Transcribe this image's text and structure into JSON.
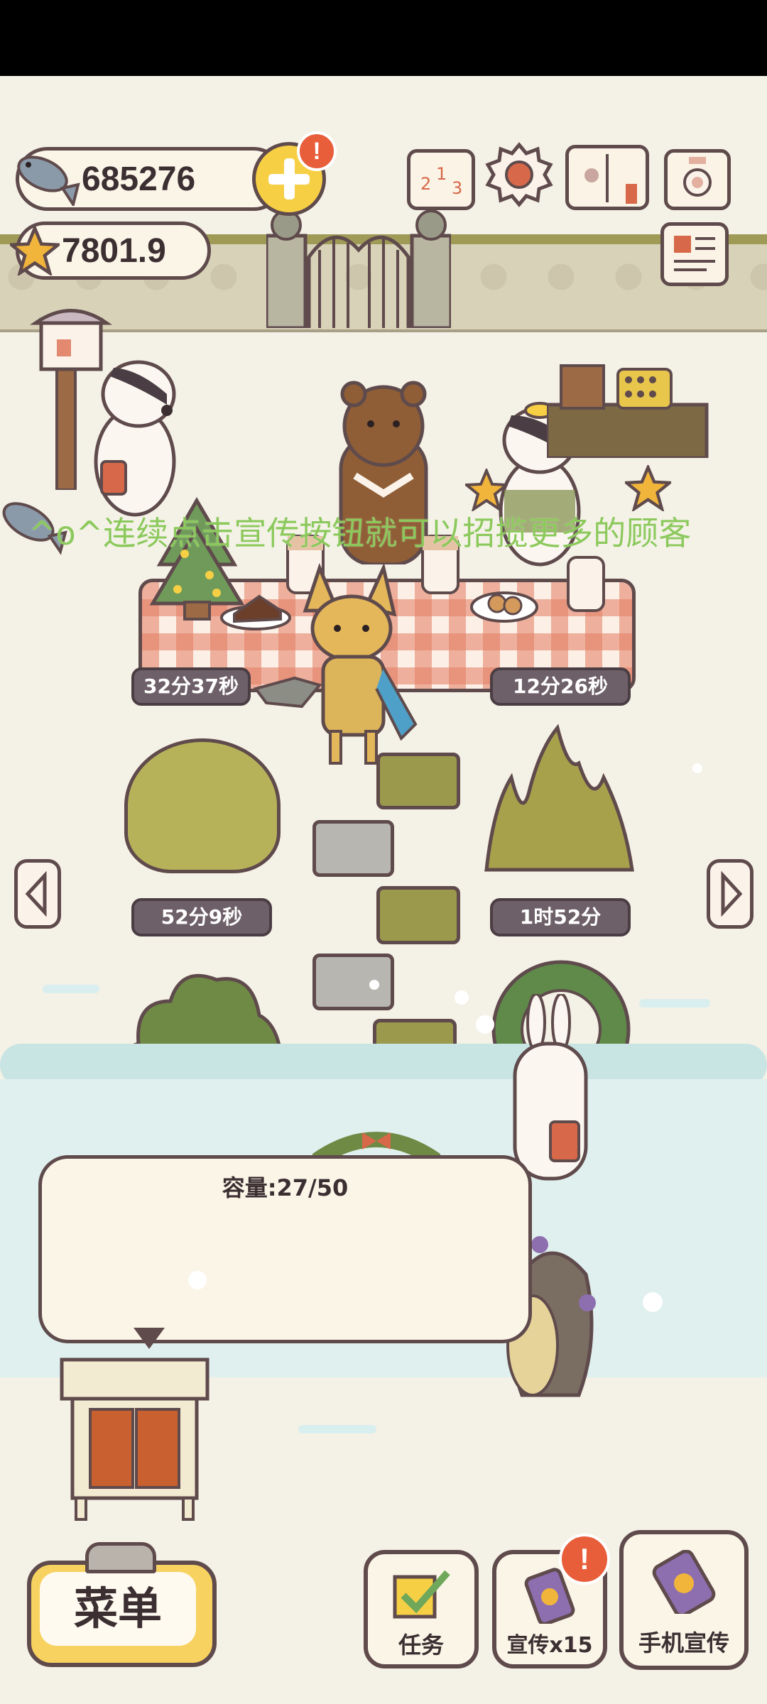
{
  "hud": {
    "fish_count": "685276",
    "star_count": "7801.9",
    "plus_alert": "!",
    "promo_alert": "!"
  },
  "marquee": "^o^连续点击宣传按钮就可以招揽更多的顾客",
  "timers": {
    "table_left": "32分37秒",
    "table_right": "12分26秒",
    "bush_left": "52分9秒",
    "bush_right": "1时52分"
  },
  "bubble": {
    "capacity": "容量:27/50"
  },
  "buttons": {
    "menu": "菜单",
    "tasks": "任务",
    "promote": "宣传x15",
    "phone_promote": "手机宣传"
  },
  "icons": [
    "fish-icon",
    "star-icon",
    "plus-icon",
    "leaderboard-icon",
    "gear-icon",
    "book-icon",
    "camera-icon",
    "newspaper-icon",
    "left-arrow-icon",
    "right-arrow-icon",
    "checkbox-icon",
    "phone-icon"
  ],
  "colors": {
    "accent_yellow": "#f6cf45",
    "alert_red": "#e85e3a",
    "outline": "#5f4a4c",
    "marquee_green": "#8cc95c"
  }
}
